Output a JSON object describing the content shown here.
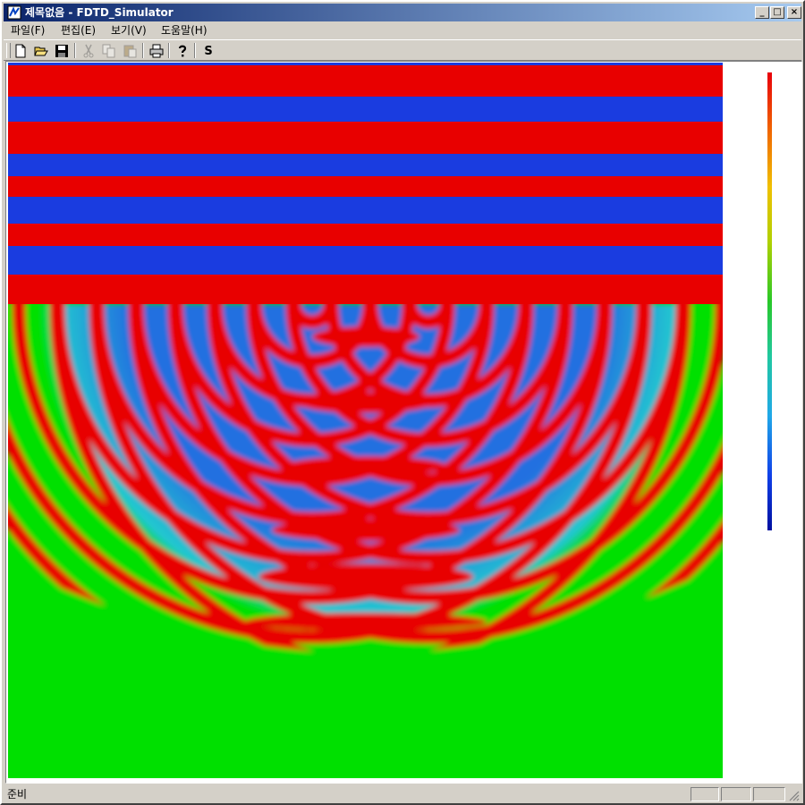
{
  "window": {
    "title": "제목없음 - FDTD_Simulator",
    "controls": {
      "minimize": "_",
      "maximize": "□",
      "close": "×"
    }
  },
  "menu": [
    {
      "label": "파일(F)"
    },
    {
      "label": "편집(E)"
    },
    {
      "label": "보기(V)"
    },
    {
      "label": "도움말(H)"
    }
  ],
  "toolbar": [
    {
      "icon": "new-file-icon",
      "enabled": true
    },
    {
      "icon": "open-folder-icon",
      "enabled": true
    },
    {
      "icon": "save-disk-icon",
      "enabled": true
    },
    {
      "icon": "cut-icon",
      "enabled": false
    },
    {
      "icon": "copy-icon",
      "enabled": false
    },
    {
      "icon": "paste-icon",
      "enabled": false
    },
    {
      "icon": "print-icon",
      "enabled": true
    },
    {
      "icon": "help-icon",
      "enabled": true
    },
    {
      "icon": "s-text-icon",
      "label": "S",
      "enabled": true
    }
  ],
  "colors": {
    "field_red": "#e80000",
    "field_blue": "#1a3ce0",
    "field_green": "#00e000",
    "colorbar_top": "#e8000a",
    "colorbar_bottom": "#0010a0"
  },
  "status": {
    "text": "준비"
  }
}
